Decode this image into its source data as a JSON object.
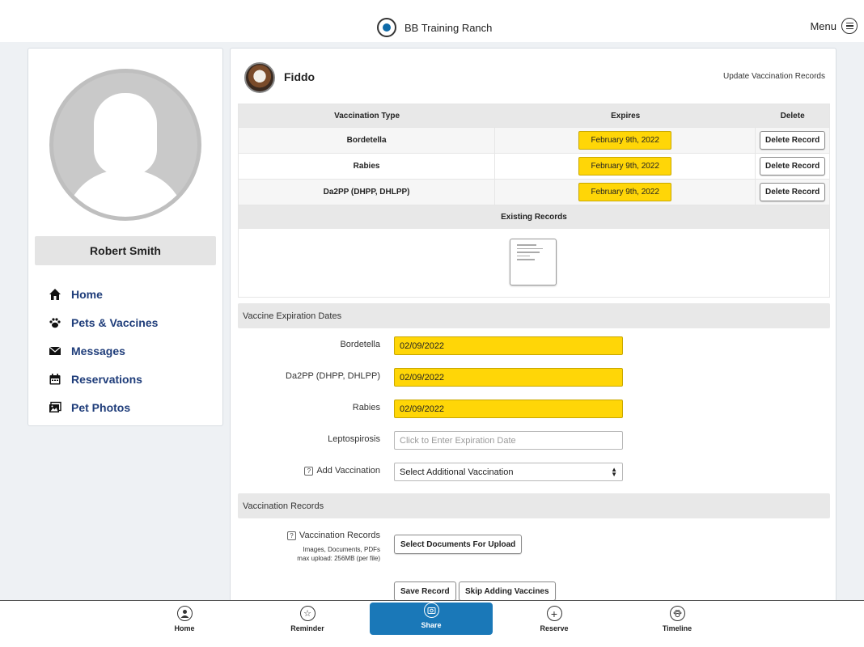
{
  "header": {
    "brand_name": "BB Training Ranch",
    "menu_label": "Menu"
  },
  "profile": {
    "name": "Robert Smith"
  },
  "sidebar": {
    "items": [
      {
        "label": "Home",
        "icon": "home-icon"
      },
      {
        "label": "Pets & Vaccines",
        "icon": "paw-icon"
      },
      {
        "label": "Messages",
        "icon": "envelope-icon"
      },
      {
        "label": "Reservations",
        "icon": "calendar-icon"
      },
      {
        "label": "Pet Photos",
        "icon": "photos-icon"
      }
    ]
  },
  "pet": {
    "name": "Fiddo",
    "update_link": "Update Vaccination Records"
  },
  "vaccination_table": {
    "columns": [
      "Vaccination Type",
      "Expires",
      "Delete"
    ],
    "rows": [
      {
        "type": "Bordetella",
        "expires": "February 9th, 2022",
        "delete_label": "Delete Record"
      },
      {
        "type": "Rabies",
        "expires": "February 9th, 2022",
        "delete_label": "Delete Record"
      },
      {
        "type": "Da2PP (DHPP, DHLPP)",
        "expires": "February 9th, 2022",
        "delete_label": "Delete Record"
      }
    ],
    "existing_records_label": "Existing Records"
  },
  "expiration_section": {
    "title": "Vaccine Expiration Dates",
    "fields": [
      {
        "label": "Bordetella",
        "value": "02/09/2022"
      },
      {
        "label": "Da2PP (DHPP, DHLPP)",
        "value": "02/09/2022"
      },
      {
        "label": "Rabies",
        "value": "02/09/2022"
      },
      {
        "label": "Leptospirosis",
        "value": "",
        "placeholder": "Click to Enter Expiration Date"
      }
    ],
    "add_vaccination_label": "Add Vaccination",
    "add_vaccination_selected": "Select Additional Vaccination"
  },
  "records_section": {
    "title": "Vaccination Records",
    "upload_label": "Vaccination Records",
    "upload_sub1": "Images, Documents, PDFs",
    "upload_sub2": "max upload: 256MB (per file)",
    "upload_button": "Select Documents For Upload",
    "save_button": "Save Record",
    "skip_button": "Skip Adding Vaccines"
  },
  "bottom_nav": {
    "tabs": [
      {
        "label": "Home",
        "icon": "user-circle-icon"
      },
      {
        "label": "Reminder",
        "icon": "star-icon"
      },
      {
        "label": "Share",
        "icon": "camera-icon",
        "active": true
      },
      {
        "label": "Reserve",
        "icon": "plus-icon"
      },
      {
        "label": "Timeline",
        "icon": "paw-icon"
      }
    ]
  },
  "colors": {
    "accent_yellow": "#ffd607",
    "nav_blue": "#1f3d7a",
    "active_tab_blue": "#1a78b8"
  }
}
